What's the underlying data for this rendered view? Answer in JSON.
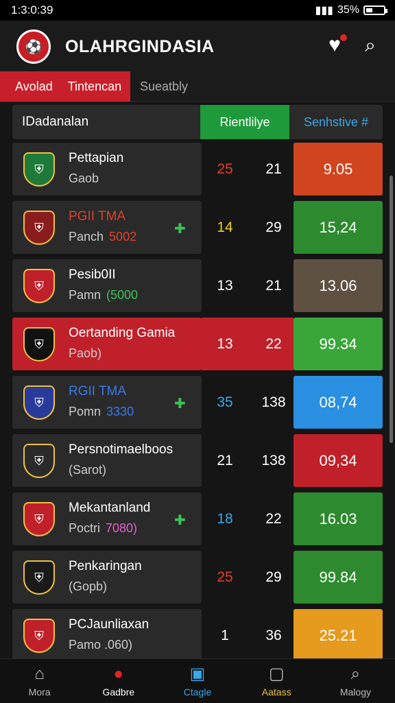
{
  "statusbar": {
    "time": "1:3:0:39",
    "battery": "35%",
    "battery_level": 0.35
  },
  "app": {
    "title": "OLAHRGINDASIA"
  },
  "tabs": [
    {
      "label": "Avolad"
    },
    {
      "label": "Tintencan"
    },
    {
      "label": "Sueatbly"
    }
  ],
  "table": {
    "headers": {
      "name": "IDadanalan",
      "middle": "Rientlilye",
      "score": "Senhstive #"
    },
    "rows": [
      {
        "name": "Pettapian",
        "sub": "Gaob",
        "tag": "",
        "rank": "25",
        "mid": "21",
        "score": "9.05",
        "score_color": "#d0451f",
        "rank_color": "#e0402a"
      },
      {
        "name": "PGII TMA",
        "sub": "Panch",
        "tag": "5002",
        "rank": "14",
        "mid": "29",
        "score": "15,24",
        "score_color": "#2e8a2e",
        "rank_color": "#f0d020",
        "name_color": "#e0402a",
        "tag_color": "#e0402a"
      },
      {
        "name": "Pesib0II",
        "sub": "Pamn",
        "tag": "(5000",
        "rank": "13",
        "mid": "21",
        "score": "13.06",
        "score_color": "#5e5142",
        "rank_color": "#ffffff",
        "tag_color": "#3cc25a"
      },
      {
        "name": "Oertanding Gamia",
        "sub": "Paob)",
        "tag": "",
        "rank": "13",
        "mid": "22",
        "score": "99.34",
        "score_color": "#3aa63a",
        "rank_color": "#ffffff"
      },
      {
        "name": "RGII TMA",
        "sub": "Pomn",
        "tag": "3330",
        "rank": "35",
        "mid": "138",
        "score": "08,74",
        "score_color": "#2a8fe0",
        "rank_color": "#3aa7e8",
        "name_color": "#3a7ae8",
        "tag_color": "#3a7ae8"
      },
      {
        "name": "Persnotimaelboos",
        "sub": "(Sarot)",
        "tag": "",
        "rank": "21",
        "mid": "138",
        "score": "09,34",
        "score_color": "#c0202a",
        "rank_color": "#ffffff"
      },
      {
        "name": "Mekantanland",
        "sub": "Poctri",
        "tag": "7080)",
        "rank": "18",
        "mid": "22",
        "score": "16.03",
        "score_color": "#2e8a2e",
        "rank_color": "#3aa7e8",
        "tag_color": "#e060d0"
      },
      {
        "name": "Penkaringan",
        "sub": "(Gopb)",
        "tag": "",
        "rank": "25",
        "mid": "29",
        "score": "99.84",
        "score_color": "#2e8a2e",
        "rank_color": "#e0402a"
      },
      {
        "name": "PCJaunliaxan",
        "sub": "Pamo .060)",
        "tag": "",
        "rank": "1",
        "mid": "36",
        "score": "25.21",
        "score_color": "#e69a1e",
        "rank_color": "#ffffff"
      }
    ]
  },
  "bottomnav": [
    {
      "label": "Mora",
      "icon": "home-icon"
    },
    {
      "label": "Gadbre",
      "icon": "ball-icon"
    },
    {
      "label": "Ctagle",
      "icon": "inbox-icon"
    },
    {
      "label": "Aatass",
      "icon": "box-icon"
    },
    {
      "label": "Malogy",
      "icon": "search-icon"
    }
  ]
}
